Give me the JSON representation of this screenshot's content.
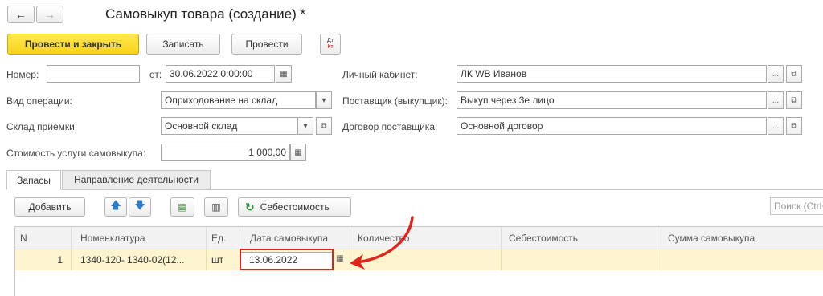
{
  "window": {
    "title": "Самовыкуп товара (создание) *"
  },
  "nav": {
    "back": "←",
    "forward": "→"
  },
  "toolbar": {
    "post_close": "Провести и закрыть",
    "save": "Записать",
    "post": "Провести",
    "dtkt_top": "Дт",
    "dtkt_bottom": "Кт"
  },
  "form": {
    "number_label": "Номер:",
    "number_value": "",
    "date_label": "от:",
    "date_value": "30.06.2022  0:00:00",
    "operation_label": "Вид операции:",
    "operation_value": "Оприходование на склад",
    "warehouse_label": "Склад приемки:",
    "warehouse_value": "Основной склад",
    "cost_label": "Стоимость услуги самовыкупа:",
    "cost_value": "1 000,00",
    "cabinet_label": "Личный кабинет:",
    "cabinet_value": "ЛК WB Иванов",
    "supplier_label": "Поставщик (выкупщик):",
    "supplier_value": "Выкуп через 3е лицо",
    "contract_label": "Договор поставщика:",
    "contract_value": "Основной договор",
    "ellipsis": "...",
    "open_glyph": "⧉"
  },
  "tabs": [
    {
      "label": "Запасы",
      "active": true
    },
    {
      "label": "Направление деятельности",
      "active": false
    }
  ],
  "table_toolbar": {
    "add": "Добавить",
    "cost": "Себестоимость",
    "search_placeholder": "Поиск (Ctrl+F)"
  },
  "table": {
    "columns": [
      "N",
      "Номенклатура",
      "Ед.",
      "Дата самовыкупа",
      "Количество",
      "Себестоимость",
      "Сумма самовыкупа"
    ],
    "rows": [
      {
        "n": "1",
        "item": "1340-120- 1340-02(12...",
        "unit": "шт",
        "date": "13.06.2022",
        "qty": "",
        "cost": "",
        "sum": ""
      }
    ]
  },
  "colors": {
    "accent_yellow": "#f7d21b",
    "row_highlight": "#fdf5cf",
    "annotation_red": "#e3231b"
  }
}
